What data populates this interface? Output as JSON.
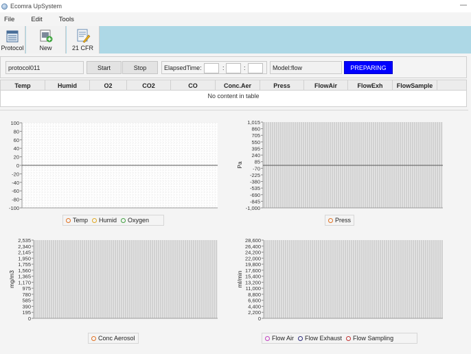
{
  "window": {
    "title": "Ecomra UpSystem"
  },
  "menu": [
    "File",
    "Edit",
    "Tools"
  ],
  "toolbar": [
    {
      "label": "Protocol",
      "icon": "protocol-icon"
    },
    {
      "label": "New",
      "icon": "new-icon"
    },
    {
      "label": "21 CFR",
      "icon": "cfr-icon"
    }
  ],
  "controls": {
    "protocol_value": "protocol011",
    "start_label": "Start",
    "stop_label": "Stop",
    "elapsed_label": "ElapsedTime:",
    "elapsed_sep": ":",
    "model_value": "Model:flow",
    "status_label": "PREPARING"
  },
  "table": {
    "columns": [
      "Temp",
      "Humid",
      "O2",
      "CO2",
      "CO",
      "Conc.Aer",
      "Press",
      "FlowAir",
      "FlowExh",
      "FlowSample"
    ],
    "empty_text": "No content in table"
  },
  "chart_data": [
    {
      "type": "line",
      "ylabel": "",
      "yticks": [
        "100",
        "80",
        "60",
        "40",
        "20",
        "0",
        "-20",
        "-40",
        "-60",
        "-80",
        "-100"
      ],
      "ylim": [
        -100,
        100
      ],
      "grid": "dashed",
      "series": [
        {
          "name": "Temp",
          "color": "#e07020",
          "values": []
        },
        {
          "name": "Humid",
          "color": "#e0a820",
          "values": []
        },
        {
          "name": "Oxygen",
          "color": "#40a040",
          "values": []
        }
      ]
    },
    {
      "type": "line",
      "ylabel": "Pa",
      "yticks": [
        "1,015",
        "860",
        "705",
        "550",
        "395",
        "240",
        "85",
        "-70",
        "-225",
        "-380",
        "-535",
        "-690",
        "-845",
        "-1,000"
      ],
      "ylim": [
        -1000,
        1015
      ],
      "grid": "dense",
      "series": [
        {
          "name": "Press",
          "color": "#e07020",
          "values": []
        }
      ]
    },
    {
      "type": "line",
      "ylabel": "mg/m3",
      "yticks": [
        "2,535",
        "2,340",
        "2,145",
        "1,950",
        "1,755",
        "1,560",
        "1,365",
        "1,170",
        "975",
        "780",
        "585",
        "390",
        "195",
        "0"
      ],
      "ylim": [
        0,
        2535
      ],
      "grid": "dense",
      "series": [
        {
          "name": "Conc Aerosol",
          "color": "#e07020",
          "values": []
        }
      ]
    },
    {
      "type": "line",
      "ylabel": "ml/min",
      "yticks": [
        "28,600",
        "26,400",
        "24,200",
        "22,000",
        "19,800",
        "17,600",
        "15,400",
        "13,200",
        "11,000",
        "8,800",
        "6,600",
        "4,400",
        "2,200",
        "0"
      ],
      "ylim": [
        0,
        28600
      ],
      "grid": "dense",
      "series": [
        {
          "name": "Flow Air",
          "color": "#c040c0",
          "values": []
        },
        {
          "name": "Flow Exhaust",
          "color": "#2a2a7a",
          "values": []
        },
        {
          "name": "Flow Sampling",
          "color": "#c03030",
          "values": []
        }
      ]
    }
  ]
}
